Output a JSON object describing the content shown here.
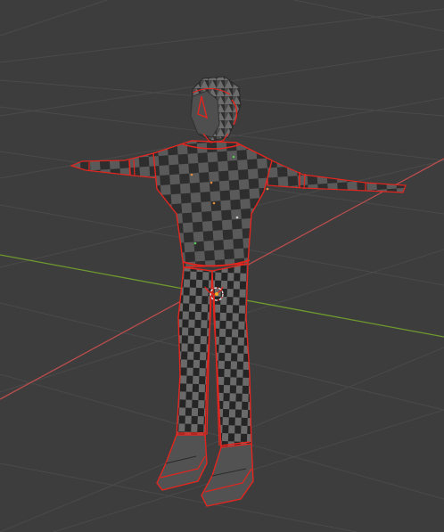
{
  "viewport": {
    "background_color": "#3d3d3d",
    "grid_color": "#4a4a4a",
    "x_axis_color": "#c65a5a",
    "y_axis_color": "#7fa83a",
    "mesh_color": "#4b4b4b",
    "mesh_dark": "#2a2a2a",
    "mesh_light": "#7a7a7a",
    "seam_color": "#e2261f",
    "cursor_color": "#f5a623"
  },
  "model": {
    "icon": "character-mesh-icon",
    "origin_icon": "3d-cursor-icon"
  }
}
